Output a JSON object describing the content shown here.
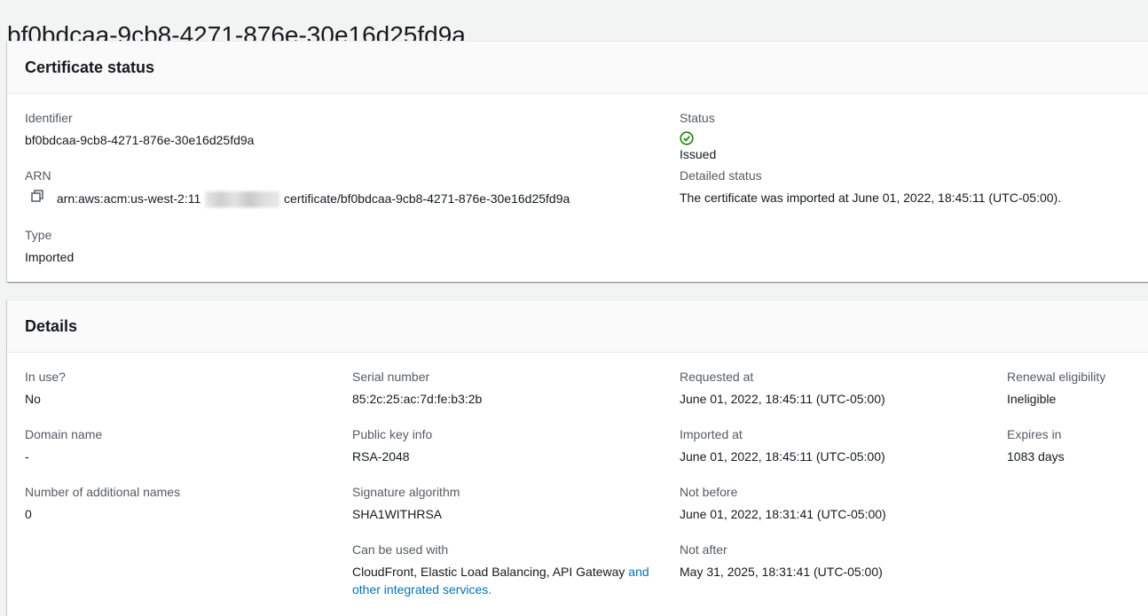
{
  "page": {
    "title": "bf0bdcaa-9cb8-4271-876e-30e16d25fd9a"
  },
  "certificate_status": {
    "heading": "Certificate status",
    "identifier": {
      "label": "Identifier",
      "value": "bf0bdcaa-9cb8-4271-876e-30e16d25fd9a"
    },
    "arn": {
      "label": "ARN",
      "prefix": "arn:aws:acm:us-west-2:11",
      "suffix": "certificate/bf0bdcaa-9cb8-4271-876e-30e16d25fd9a",
      "copy_icon": "copy-icon"
    },
    "type": {
      "label": "Type",
      "value": "Imported"
    },
    "status": {
      "label": "Status",
      "value": "Issued",
      "icon": "check-circle-icon",
      "color": "#1d8102"
    },
    "detailed_status": {
      "label": "Detailed status",
      "value": "The certificate was imported at June 01, 2022, 18:45:11 (UTC-05:00)."
    }
  },
  "details": {
    "heading": "Details",
    "in_use": {
      "label": "In use?",
      "value": "No"
    },
    "domain_name": {
      "label": "Domain name",
      "value": "-"
    },
    "additional_names": {
      "label": "Number of additional names",
      "value": "0"
    },
    "serial_number": {
      "label": "Serial number",
      "value": "85:2c:25:ac:7d:fe:b3:2b"
    },
    "public_key_info": {
      "label": "Public key info",
      "value": "RSA-2048"
    },
    "signature_algorithm": {
      "label": "Signature algorithm",
      "value": "SHA1WITHRSA"
    },
    "can_be_used_with": {
      "label": "Can be used with",
      "value": "CloudFront, Elastic Load Balancing, API Gateway ",
      "link_text": "and other integrated services."
    },
    "requested_at": {
      "label": "Requested at",
      "value": "June 01, 2022, 18:45:11 (UTC-05:00)"
    },
    "imported_at": {
      "label": "Imported at",
      "value": "June 01, 2022, 18:45:11 (UTC-05:00)"
    },
    "not_before": {
      "label": "Not before",
      "value": "June 01, 2022, 18:31:41 (UTC-05:00)"
    },
    "not_after": {
      "label": "Not after",
      "value": "May 31, 2025, 18:31:41 (UTC-05:00)"
    },
    "renewal_eligibility": {
      "label": "Renewal eligibility",
      "value": "Ineligible"
    },
    "expires_in": {
      "label": "Expires in",
      "value": "1083 days"
    }
  },
  "colors": {
    "background": "#f2f3f3",
    "label": "#545b64",
    "text": "#16191f",
    "link": "#0073bb",
    "success": "#1d8102"
  }
}
